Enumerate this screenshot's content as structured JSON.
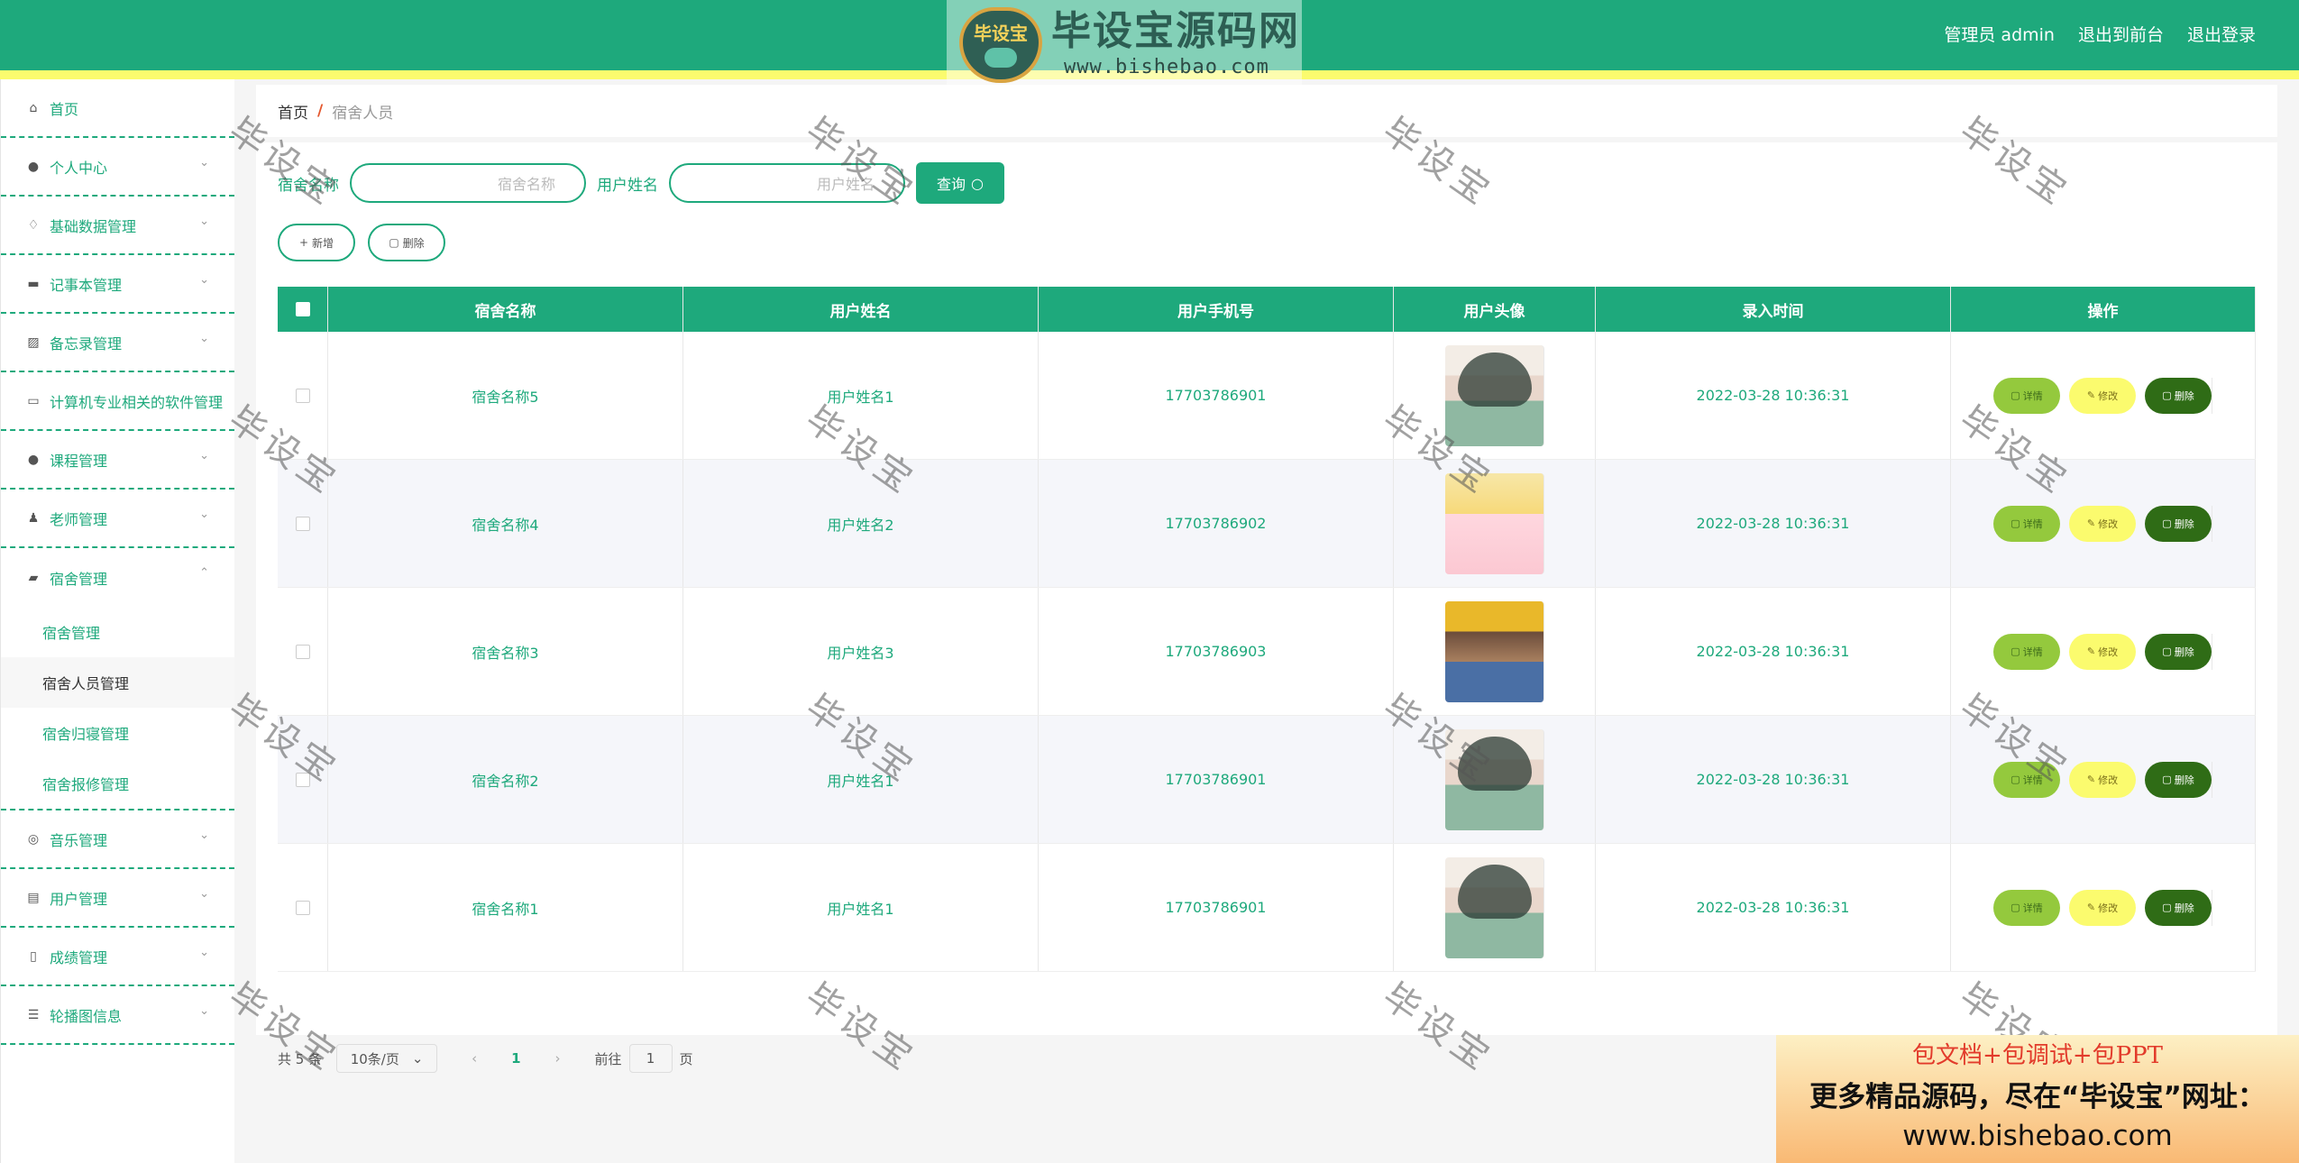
{
  "logo": {
    "badge": "毕设宝",
    "title": "毕设宝源码网",
    "url": "www.bishebao.com"
  },
  "topnav": {
    "user": "管理员 admin",
    "front": "退出到前台",
    "logout": "退出登录"
  },
  "sidebar": {
    "items": [
      {
        "label": "首页",
        "icon": "home-icon"
      },
      {
        "label": "个人中心",
        "icon": "user-icon"
      },
      {
        "label": "基础数据管理",
        "icon": "bell-icon"
      },
      {
        "label": "记事本管理",
        "icon": "monitor-icon"
      },
      {
        "label": "备忘录管理",
        "icon": "chart-icon"
      },
      {
        "label": "计算机专业相关的软件管理",
        "icon": "chat-icon"
      },
      {
        "label": "课程管理",
        "icon": "user-icon"
      },
      {
        "label": "老师管理",
        "icon": "stamp-icon"
      },
      {
        "label": "宿舍管理",
        "icon": "folder-icon"
      }
    ],
    "sub": [
      "宿舍管理",
      "宿舍人员管理",
      "宿舍归寝管理",
      "宿舍报修管理"
    ],
    "items2": [
      {
        "label": "音乐管理",
        "icon": "compass-icon"
      },
      {
        "label": "用户管理",
        "icon": "clipboard-icon"
      },
      {
        "label": "成绩管理",
        "icon": "mic-icon"
      },
      {
        "label": "轮播图信息",
        "icon": "sliders-icon"
      }
    ]
  },
  "breadcrumb": {
    "home": "首页",
    "sep": "/",
    "current": "宿舍人员"
  },
  "search": {
    "label1": "宿舍名称",
    "ph1": "宿舍名称",
    "label2": "用户姓名",
    "ph2": "用户姓名",
    "btn": "查询"
  },
  "actions": {
    "add": "新增",
    "del": "删除"
  },
  "table": {
    "headers": [
      "宿舍名称",
      "用户姓名",
      "用户手机号",
      "用户头像",
      "录入时间",
      "操作"
    ],
    "rows": [
      {
        "dorm": "宿舍名称5",
        "name": "用户姓名1",
        "phone": "17703786901",
        "time": "2022-03-28 10:36:31"
      },
      {
        "dorm": "宿舍名称4",
        "name": "用户姓名2",
        "phone": "17703786902",
        "time": "2022-03-28 10:36:31"
      },
      {
        "dorm": "宿舍名称3",
        "name": "用户姓名3",
        "phone": "17703786903",
        "time": "2022-03-28 10:36:31"
      },
      {
        "dorm": "宿舍名称2",
        "name": "用户姓名1",
        "phone": "17703786901",
        "time": "2022-03-28 10:36:31"
      },
      {
        "dorm": "宿舍名称1",
        "name": "用户姓名1",
        "phone": "17703786901",
        "time": "2022-03-28 10:36:31"
      }
    ],
    "ops": {
      "detail": "详情",
      "edit": "修改",
      "del": "删除"
    }
  },
  "pager": {
    "total": "共 5 条",
    "size": "10条/页",
    "page": "1",
    "goto": "前往",
    "goto_val": "1",
    "page_unit": "页"
  },
  "watermark": "毕设宝",
  "ad": {
    "line1": "包文档+包调试+包PPT",
    "line2": "更多精品源码，尽在“毕设宝”网址：",
    "line3": "www.bishebao.com"
  },
  "colors": {
    "primary": "#1ea97c",
    "accent": "#fbfb6e",
    "detail": "#94c93d",
    "danger": "#2f6c16"
  }
}
